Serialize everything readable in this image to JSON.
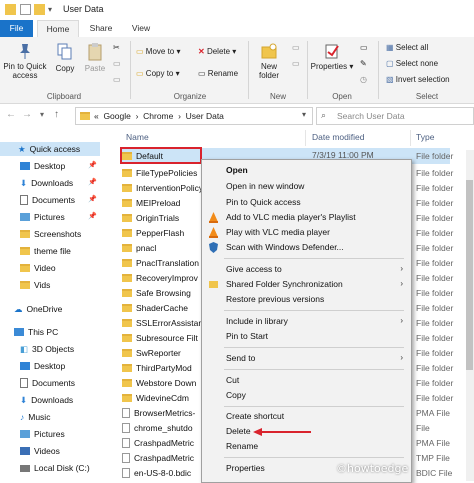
{
  "window": {
    "title": "User Data"
  },
  "ribbon_tabs": [
    "File",
    "Home",
    "Share",
    "View"
  ],
  "ribbon": {
    "pin": "Pin to Quick\naccess",
    "copy": "Copy",
    "paste": "Paste",
    "clipboard": "Clipboard",
    "move_to": "Move to",
    "copy_to": "Copy to",
    "delete": "Delete",
    "rename": "Rename",
    "organize": "Organize",
    "new_folder": "New\nfolder",
    "new": "New",
    "properties": "Properties",
    "open": "Open",
    "select_all": "Select all",
    "select_none": "Select none",
    "invert": "Invert selection",
    "select": "Select"
  },
  "address": {
    "path": "«  Google  ›  Chrome  ›  User Data",
    "search_placeholder": "Search User Data"
  },
  "nav": [
    {
      "label": "Quick access",
      "selected": true
    },
    {
      "label": "Desktop"
    },
    {
      "label": "Downloads"
    },
    {
      "label": "Documents"
    },
    {
      "label": "Pictures"
    },
    {
      "label": "Screenshots"
    },
    {
      "label": "theme file"
    },
    {
      "label": "Video"
    },
    {
      "label": "Vids"
    },
    {
      "label": "OneDrive"
    },
    {
      "label": "This PC"
    },
    {
      "label": "3D Objects"
    },
    {
      "label": "Desktop"
    },
    {
      "label": "Documents"
    },
    {
      "label": "Downloads"
    },
    {
      "label": "Music"
    },
    {
      "label": "Pictures"
    },
    {
      "label": "Videos"
    },
    {
      "label": "Local Disk (C:)"
    }
  ],
  "columns": {
    "name": "Name",
    "date": "Date modified",
    "type": "Type"
  },
  "files": [
    {
      "name": "Default",
      "date": "7/3/19 11:00 PM",
      "type": "File folder"
    },
    {
      "name": "FileTypePolicies",
      "type": "File folder"
    },
    {
      "name": "InterventionPolicy",
      "type": "File folder"
    },
    {
      "name": "MEIPreload",
      "type": "File folder"
    },
    {
      "name": "OriginTrials",
      "type": "File folder"
    },
    {
      "name": "PepperFlash",
      "type": "File folder"
    },
    {
      "name": "pnacl",
      "type": "File folder"
    },
    {
      "name": "PnaclTranslation",
      "type": "File folder"
    },
    {
      "name": "RecoveryImprov",
      "type": "File folder"
    },
    {
      "name": "Safe Browsing",
      "type": "File folder"
    },
    {
      "name": "ShaderCache",
      "type": "File folder"
    },
    {
      "name": "SSLErrorAssistan",
      "type": "File folder"
    },
    {
      "name": "Subresource Filt",
      "type": "File folder"
    },
    {
      "name": "SwReporter",
      "type": "File folder"
    },
    {
      "name": "ThirdPartyMod",
      "type": "File folder"
    },
    {
      "name": "Webstore Down",
      "type": "File folder"
    },
    {
      "name": "WidevineCdm",
      "type": "File folder"
    },
    {
      "name": "BrowserMetrics-",
      "type": "PMA File"
    },
    {
      "name": "chrome_shutdo",
      "type": "File"
    },
    {
      "name": "CrashpadMetric",
      "type": "PMA File"
    },
    {
      "name": "CrashpadMetric",
      "type": "TMP File"
    },
    {
      "name": "en-US-8-0.bdic",
      "type": "BDIC File"
    }
  ],
  "context_menu": [
    "Open",
    "Open in new window",
    "Pin to Quick access",
    "Add to VLC media player's Playlist",
    "Play with VLC media player",
    "Scan with Windows Defender...",
    "Give access to",
    "Shared Folder Synchronization",
    "Restore previous versions",
    "Include in library",
    "Pin to Start",
    "Send to",
    "Cut",
    "Copy",
    "Create shortcut",
    "Delete",
    "Rename",
    "Properties"
  ],
  "watermark": "©howtoedge",
  "colors": {
    "accent": "#1a73c9",
    "highlight": "#cce4f7",
    "annotation_red": "#d9232d"
  }
}
